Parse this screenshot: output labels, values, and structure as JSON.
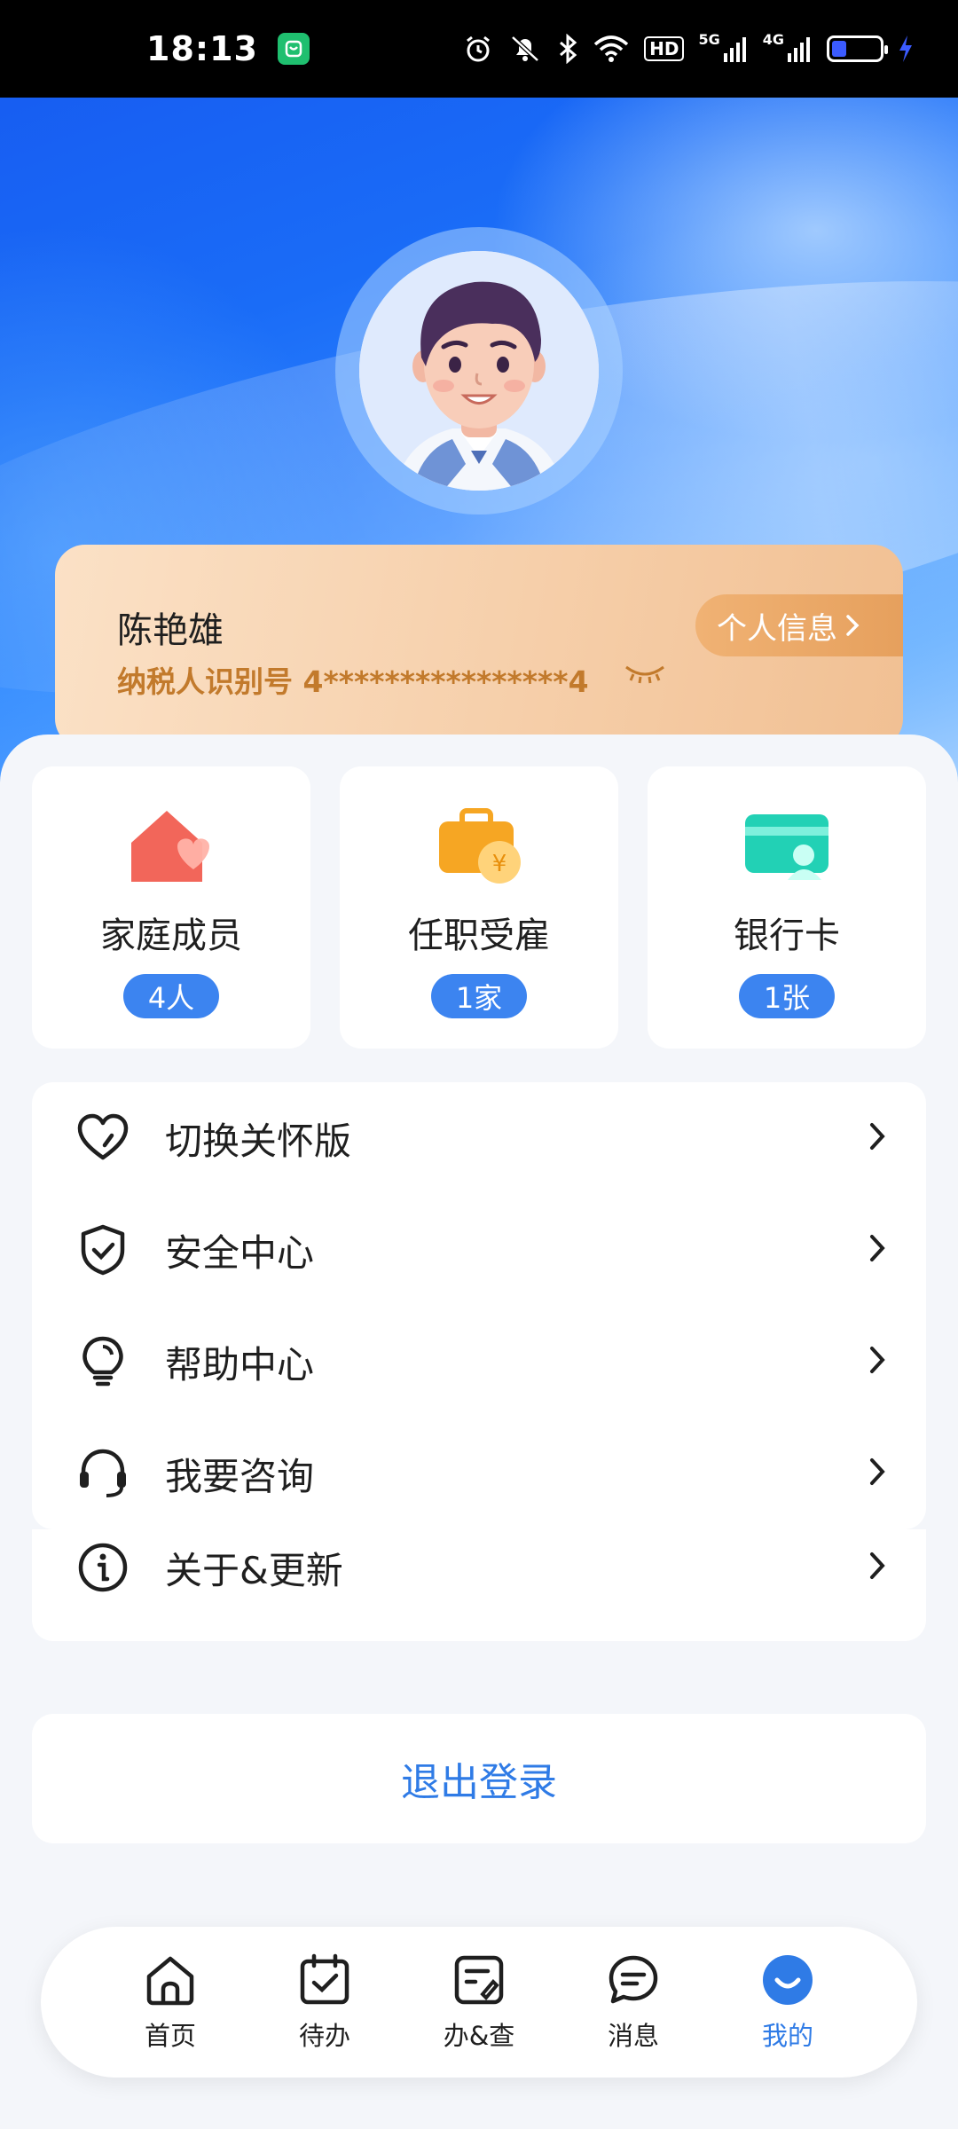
{
  "status_bar": {
    "time": "18:13",
    "network_1": "5G",
    "network_2": "4G",
    "hd_label": "HD",
    "icons": [
      "alarm-icon",
      "mute-icon",
      "bluetooth-icon",
      "wifi-icon",
      "battery-icon",
      "charging-icon"
    ],
    "battery_level": 0.3
  },
  "profile": {
    "name": "陈艳雄",
    "taxpayer_id": "纳税人识别号 4****************4",
    "info_button": "个人信息"
  },
  "quick_cards": [
    {
      "label": "家庭成员",
      "badge": "4人",
      "icon": "family-house-icon"
    },
    {
      "label": "任职受雇",
      "badge": "1家",
      "icon": "employment-briefcase-icon"
    },
    {
      "label": "银行卡",
      "badge": "1张",
      "icon": "bank-card-icon"
    }
  ],
  "menu": [
    {
      "label": "切换关怀版",
      "icon": "heart-icon"
    },
    {
      "label": "安全中心",
      "icon": "shield-check-icon"
    },
    {
      "label": "帮助中心",
      "icon": "lightbulb-icon"
    },
    {
      "label": "我要咨询",
      "icon": "headset-icon"
    },
    {
      "label": "关于&更新",
      "icon": "info-icon"
    }
  ],
  "logout_label": "退出登录",
  "bottom_nav": [
    {
      "label": "首页",
      "icon": "home-icon",
      "active": false
    },
    {
      "label": "待办",
      "icon": "calendar-check-icon",
      "active": false
    },
    {
      "label": "办&查",
      "icon": "document-edit-icon",
      "active": false
    },
    {
      "label": "消息",
      "icon": "chat-bubble-icon",
      "active": false
    },
    {
      "label": "我的",
      "icon": "smile-profile-icon",
      "active": true
    }
  ],
  "colors": {
    "accent": "#2f7be6",
    "badge": "#3c84f0",
    "id_text": "#c27a2c"
  }
}
